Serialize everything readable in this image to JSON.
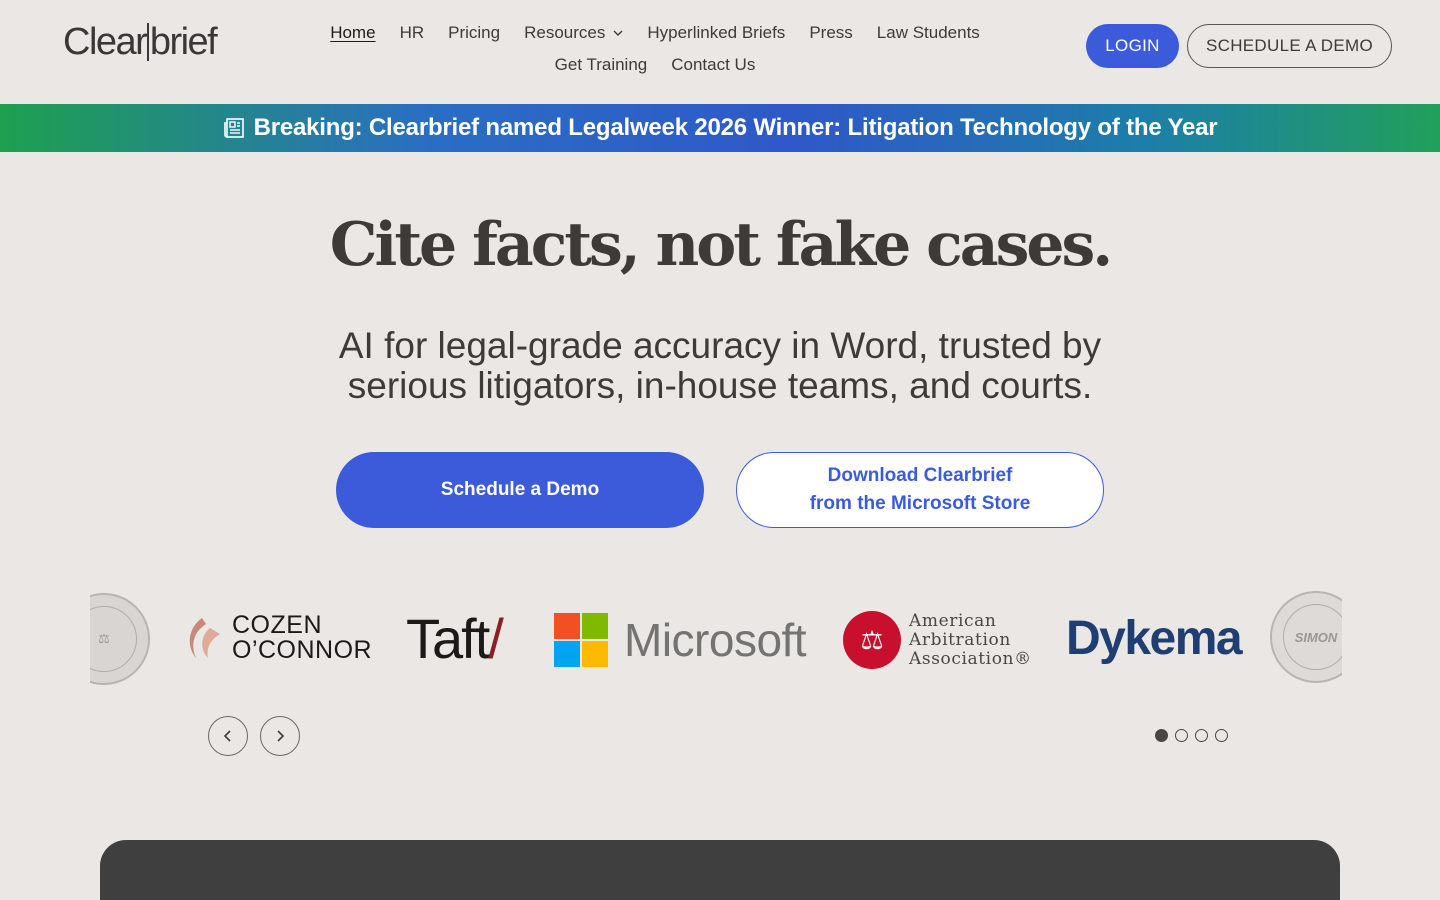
{
  "header": {
    "logo_text_a": "Clear",
    "logo_text_b": "brief",
    "nav": [
      {
        "label": "Home",
        "active": true
      },
      {
        "label": "HR"
      },
      {
        "label": "Pricing"
      },
      {
        "label": "Resources",
        "has_dropdown": true
      },
      {
        "label": "Hyperlinked Briefs"
      },
      {
        "label": "Press"
      },
      {
        "label": "Law Students"
      },
      {
        "label": "Get Training"
      },
      {
        "label": "Contact Us"
      }
    ],
    "login_label": "LOGIN",
    "demo_label": "SCHEDULE A DEMO"
  },
  "banner": {
    "icon": "newspaper-icon",
    "text": "Breaking: Clearbrief named Legalweek 2026 Winner: Litigation Technology of the Year"
  },
  "hero": {
    "title": "Cite facts, not fake cases.",
    "subtitle_line1": "AI for legal-grade accuracy in Word, trusted by",
    "subtitle_line2": "serious litigators, in-house teams, and courts.",
    "cta_primary": "Schedule a Demo",
    "cta_secondary_line1": "Download Clearbrief",
    "cta_secondary_line2": "from the Microsoft Store"
  },
  "logos": {
    "cozen_line1": "COZEN",
    "cozen_line2": "O’CONNOR",
    "taft": "Taft",
    "taft_slash": "/",
    "microsoft": "Microsoft",
    "aaa_line1": "American",
    "aaa_line2": "Arbitration",
    "aaa_line3": "Association®",
    "dykema": "Dykema",
    "simon_seal": "SIMON",
    "colors": {
      "ms_red": "#f25022",
      "ms_green": "#7fba00",
      "ms_blue": "#00a4ef",
      "ms_yellow": "#ffb900"
    }
  },
  "carousel": {
    "prev_icon": "chevron-left-icon",
    "next_icon": "chevron-right-icon",
    "page_count": 4,
    "active_page": 1
  },
  "theme": {
    "accent": "#3b5bdb",
    "background": "#ebe7e4",
    "dark_panel": "#3f3f3f"
  }
}
